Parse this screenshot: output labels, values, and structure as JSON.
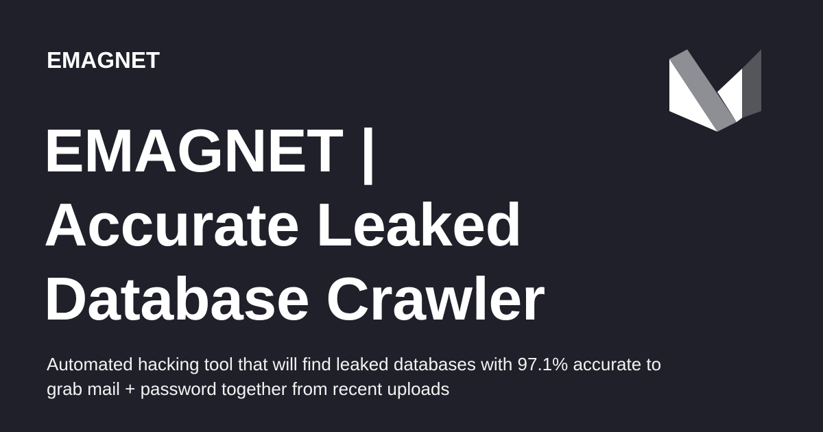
{
  "site": {
    "name": "EMAGNET"
  },
  "article": {
    "title": "EMAGNET | Accurate Leaked Database Crawler",
    "description": "Automated hacking tool that will find leaked databases with 97.1% accurate to grab mail + password together from recent uploads"
  },
  "logo": {
    "icon": "m-chevron-logo-icon",
    "colors": {
      "light": "#ffffff",
      "mid": "#8e8f94",
      "dark": "#55565c"
    }
  },
  "colors": {
    "background": "#1f2029",
    "text": "#ffffff"
  }
}
